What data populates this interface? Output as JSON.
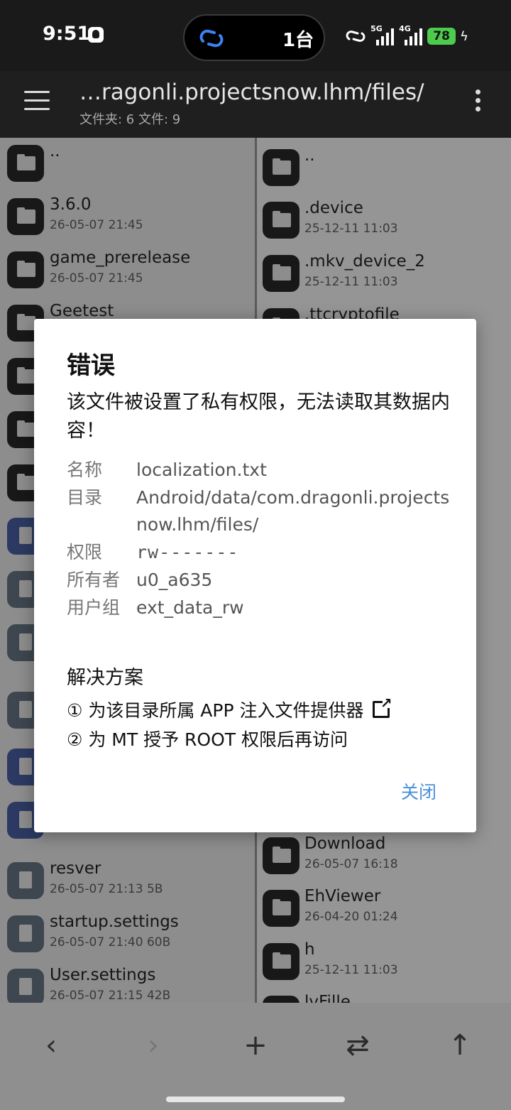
{
  "status": {
    "time": "9:51",
    "island_text": "1台",
    "net1": "5G",
    "net2": "4G",
    "battery": "78"
  },
  "appbar": {
    "path": "…ragonli.projectsnow.lhm/files/",
    "summary": "文件夹: 6  文件: 9"
  },
  "left_pane": [
    {
      "name": "..",
      "meta": "",
      "icon": "folder-icon"
    },
    {
      "name": "3.6.0",
      "meta": "26-05-07 21:45",
      "icon": "folder-icon"
    },
    {
      "name": "game_prerelease",
      "meta": "26-05-07 21:45",
      "icon": "folder-icon"
    },
    {
      "name": "Geetest",
      "meta": "",
      "icon": "folder-icon"
    },
    {
      "name": "",
      "meta": "",
      "icon": "folder-icon"
    },
    {
      "name": "",
      "meta": "",
      "icon": "folder-icon"
    },
    {
      "name": "",
      "meta": "",
      "icon": "folder-icon"
    },
    {
      "name": "",
      "meta": "",
      "icon": "note-icon"
    },
    {
      "name": "",
      "meta": "",
      "icon": "file-icon"
    },
    {
      "name": "",
      "meta": "",
      "icon": "file-icon"
    },
    {
      "name": "",
      "meta": "",
      "icon": "file-icon"
    },
    {
      "name": "",
      "meta": "",
      "icon": "note-icon"
    },
    {
      "name": "",
      "meta": "",
      "icon": "note-icon"
    },
    {
      "name": "resver",
      "meta": "26-05-07 21:13  5B",
      "icon": "file-icon"
    },
    {
      "name": "startup.settings",
      "meta": "26-05-07 21:40  60B",
      "icon": "file-icon"
    },
    {
      "name": "User.settings",
      "meta": "26-05-07 21:15  42B",
      "icon": "file-icon"
    }
  ],
  "right_pane": [
    {
      "name": "..",
      "meta": "",
      "icon": "folder-icon"
    },
    {
      "name": ".device",
      "meta": "25-12-11 11:03",
      "icon": "folder-icon"
    },
    {
      "name": ".mkv_device_2",
      "meta": "25-12-11 11:03",
      "icon": "folder-icon"
    },
    {
      "name": ".ttcryptofile",
      "meta": "",
      "icon": "folder-icon"
    },
    {
      "name": "Download",
      "meta": "26-05-07 16:18",
      "icon": "folder-icon"
    },
    {
      "name": "EhViewer",
      "meta": "26-04-20 01:24",
      "icon": "folder-icon"
    },
    {
      "name": "h",
      "meta": "25-12-11 11:03",
      "icon": "folder-icon"
    },
    {
      "name": "lvFille",
      "meta": "",
      "icon": "folder-icon"
    }
  ],
  "dialog": {
    "title": "错误",
    "message": "该文件被设置了私有权限，无法读取其数据内容！",
    "fields": [
      {
        "key": "名称",
        "value": "localization.txt"
      },
      {
        "key": "目录",
        "value": "Android/data/com.dragonli.projectsnow.lhm/files/"
      },
      {
        "key": "权限",
        "value": "rw-------"
      },
      {
        "key": "所有者",
        "value": "u0_a635"
      },
      {
        "key": "用户组",
        "value": "ext_data_rw"
      }
    ],
    "solution_title": "解决方案",
    "solution1": "① 为该目录所属 APP 注入文件提供器",
    "solution2": "② 为 MT 授予 ROOT 权限后再访问",
    "close": "关闭"
  },
  "toolbar": {
    "back": "‹",
    "forward": "›",
    "add": "+",
    "swap": "⇄",
    "up": "↑"
  }
}
